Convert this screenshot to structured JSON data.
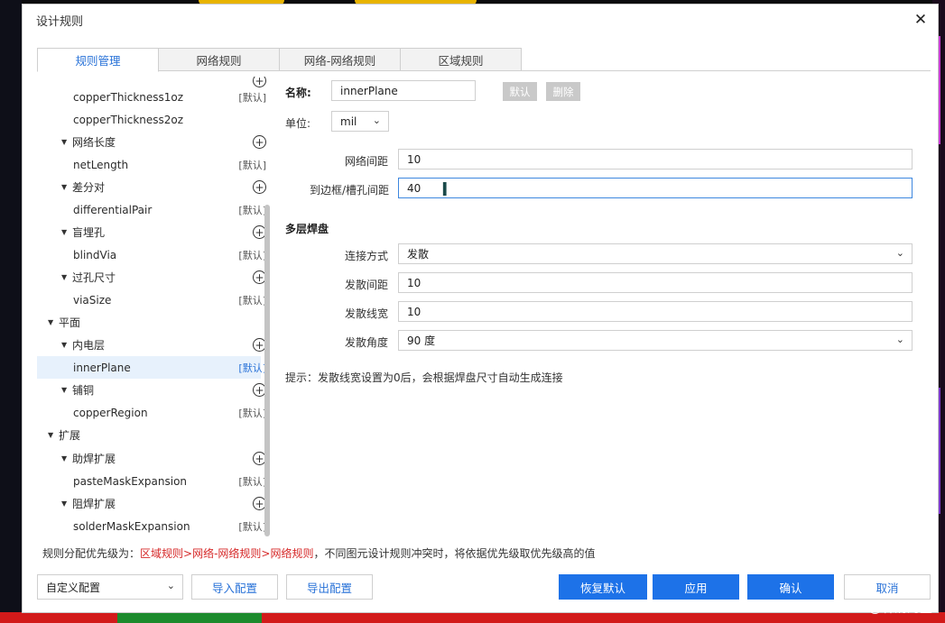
{
  "window": {
    "title": "设计规则"
  },
  "tabs": [
    "规则管理",
    "网络规则",
    "网络-网络规则",
    "区域规则"
  ],
  "tree": {
    "rows": [
      {
        "label": "copperThickness1oz",
        "tag": "[默认]"
      },
      {
        "label": "copperThickness2oz",
        "tag": ""
      },
      {
        "label": "网络长度",
        "tag": ""
      },
      {
        "label": "netLength",
        "tag": "[默认]"
      },
      {
        "label": "差分对",
        "tag": ""
      },
      {
        "label": "differentialPair",
        "tag": "[默认]"
      },
      {
        "label": "盲埋孔",
        "tag": ""
      },
      {
        "label": "blindVia",
        "tag": "[默认]"
      },
      {
        "label": "过孔尺寸",
        "tag": ""
      },
      {
        "label": "viaSize",
        "tag": "[默认]"
      },
      {
        "label": "平面",
        "tag": ""
      },
      {
        "label": "内电层",
        "tag": ""
      },
      {
        "label": "innerPlane",
        "tag": "[默认]"
      },
      {
        "label": "铺铜",
        "tag": ""
      },
      {
        "label": "copperRegion",
        "tag": "[默认]"
      },
      {
        "label": "扩展",
        "tag": ""
      },
      {
        "label": "助焊扩展",
        "tag": ""
      },
      {
        "label": "pasteMaskExpansion",
        "tag": "[默认]"
      },
      {
        "label": "阻焊扩展",
        "tag": ""
      },
      {
        "label": "solderMaskExpansion",
        "tag": "[默认]"
      }
    ]
  },
  "form": {
    "name_label": "名称:",
    "name_value": "innerPlane",
    "default_btn": "默认",
    "delete_btn": "删除",
    "unit_label": "单位:",
    "unit_value": "mil",
    "net_spacing_label": "网络间距",
    "net_spacing_value": "10",
    "edge_spacing_label": "到边框/槽孔间距",
    "edge_spacing_value": "40",
    "multilayer_pad_title": "多层焊盘",
    "connect_mode_label": "连接方式",
    "connect_mode_value": "发散",
    "spoke_spacing_label": "发散间距",
    "spoke_spacing_value": "10",
    "spoke_width_label": "发散线宽",
    "spoke_width_value": "10",
    "spoke_angle_label": "发散角度",
    "spoke_angle_value": "90 度",
    "hint": "提示：发散线宽设置为0后，会根据焊盘尺寸自动生成连接"
  },
  "footer": {
    "priority_prefix": "规则分配优先级为：",
    "priority_chain": "区域规则>网络-网络规则>网络规则",
    "priority_suffix": "，不同图元设计规则冲突时，将依据优先级取优先级高的值",
    "config_select": "自定义配置",
    "import_btn": "导入配置",
    "export_btn": "导出配置",
    "restore_btn": "恢复默认",
    "apply_btn": "应用",
    "ok_btn": "确认",
    "cancel_btn": "取消"
  },
  "watermark": "CSDN @林清海笙",
  "colors": {
    "accent": "#1d72e8",
    "link": "#2a73d8",
    "warning_red": "#d62828"
  }
}
